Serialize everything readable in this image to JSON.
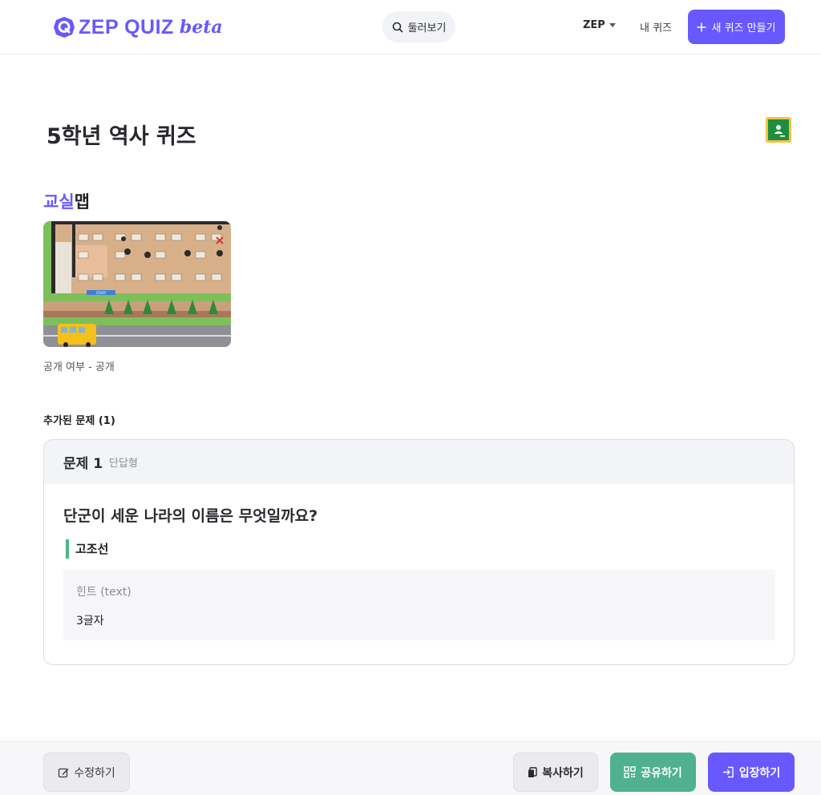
{
  "header": {
    "logo_text": "ZEP QUIZ",
    "logo_beta": "beta",
    "search_label": "둘러보기",
    "nav_zep": "ZEP",
    "nav_myquiz": "내 퀴즈",
    "new_quiz_label": "새 퀴즈 만들기"
  },
  "quiz": {
    "title": "5학년 역사 퀴즈",
    "section_title_accent": "교실",
    "section_title_rest": "맵",
    "public_status": "공개 여부 - 공개",
    "added_count": "추가된 문제 (1)"
  },
  "question": {
    "number": "문제 1",
    "type": "단답형",
    "text": "단군이 세운 나라의 이름은 무엇일까요?",
    "answer": "고조선",
    "hint_label": "힌트 (text)",
    "hint_value": "3글자"
  },
  "footer": {
    "edit_label": "수정하기",
    "copy_label": "복사하기",
    "share_label": "공유하기",
    "enter_label": "입장하기"
  },
  "map_sign": "START",
  "colors": {
    "brand": "#6758ff",
    "share": "#4fb18f",
    "answer_bar": "#47b881"
  },
  "icons": [
    "search-icon",
    "caret-down-icon",
    "plus-icon",
    "google-classroom-icon",
    "edit-icon",
    "copy-icon",
    "qr-icon",
    "enter-icon"
  ]
}
